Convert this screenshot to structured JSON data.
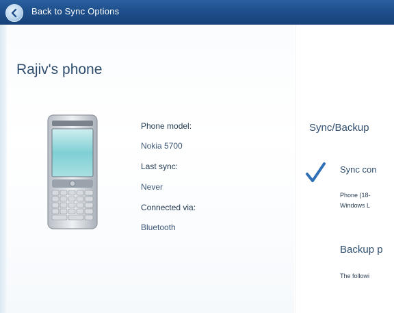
{
  "titlebar": {
    "back_label": "Back to Sync Options",
    "back_icon": "back-arrow-icon"
  },
  "device": {
    "title": "Rajiv's phone",
    "details": [
      {
        "label": "Phone model:",
        "value": "Nokia 5700"
      },
      {
        "label": "Last sync:",
        "value": "Never"
      },
      {
        "label": "Connected via:",
        "value": "Bluetooth"
      }
    ]
  },
  "sync": {
    "heading": "Sync/Backup",
    "status": "Sync con",
    "status_icon": "checkmark-icon",
    "status_detail_line1": "Phone (18-",
    "status_detail_line2": "Windows L",
    "backup_heading": "Backup p",
    "backup_detail": "The followi"
  },
  "colors": {
    "titlebar": "#1e4f8c",
    "accent": "#2f6fb6",
    "heading_text": "#2f4e6e"
  }
}
